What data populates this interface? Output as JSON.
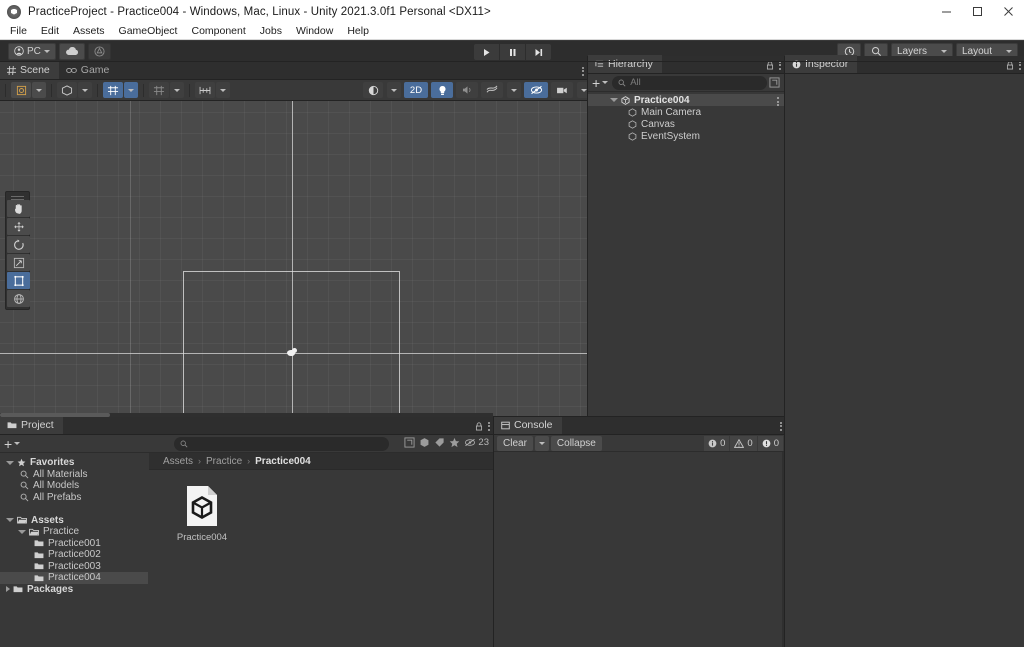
{
  "window": {
    "title": "PracticeProject - Practice004 - Windows, Mac, Linux - Unity 2021.3.0f1 Personal <DX11>",
    "app_icon": "unity-icon",
    "controls": [
      {
        "name": "minimize-button",
        "glyph": "minimize-icon"
      },
      {
        "name": "maximize-button",
        "glyph": "maximize-icon"
      },
      {
        "name": "close-button",
        "glyph": "close-icon"
      }
    ]
  },
  "menubar": {
    "items": [
      "File",
      "Edit",
      "Assets",
      "GameObject",
      "Component",
      "Jobs",
      "Window",
      "Help"
    ]
  },
  "toolbar": {
    "account_label": "PC",
    "account_icon": "account-icon",
    "cloud_icon": "cloud-icon",
    "collab_icon": "collab-icon",
    "play_icon": "play-icon",
    "pause_icon": "pause-icon",
    "step_icon": "step-icon",
    "history_icon": "undo-history-icon",
    "search_icon": "search-icon",
    "layers_label": "Layers",
    "layout_label": "Layout"
  },
  "scene": {
    "tabs": [
      {
        "label": "Scene",
        "icon": "scene-grid-icon",
        "active": true
      },
      {
        "label": "Game",
        "icon": "game-display-icon",
        "active": false
      }
    ],
    "toolbar": {
      "shading_icon": "shaded-mode-icon",
      "draw_icon": "draw-mode-icon",
      "mode_2d_label": "2D",
      "light_icon": "lighting-icon",
      "audio_icon": "audio-icon",
      "fx_icon": "effects-icon",
      "hidden_icon": "scene-visibility-icon",
      "camera_icon": "scene-camera-icon",
      "gizmos_icon": "gizmos-icon"
    },
    "tools": [
      {
        "name": "hand-tool",
        "icon": "hand-icon",
        "active": false
      },
      {
        "name": "move-tool",
        "icon": "move-icon",
        "active": false
      },
      {
        "name": "rotate-tool",
        "icon": "rotate-icon",
        "active": false
      },
      {
        "name": "scale-tool",
        "icon": "scale-icon",
        "active": false
      },
      {
        "name": "rect-tool",
        "icon": "rect-transform-icon",
        "active": true
      },
      {
        "name": "transform-tool",
        "icon": "transform-icon",
        "active": false
      }
    ],
    "viewport": {
      "canvas_rect_label": "Canvas",
      "pivot_label": "pivot-handle"
    }
  },
  "hierarchy": {
    "tab_label": "Hierarchy",
    "tab_icon": "hierarchy-icon",
    "add_label": "+",
    "search_placeholder": "All",
    "search_icon": "search-icon",
    "items": [
      {
        "label": "Practice004",
        "depth": 0,
        "icon": "scene-asset-icon",
        "expanded": true,
        "selected": true
      },
      {
        "label": "Main Camera",
        "depth": 1,
        "icon": "gameobject-icon",
        "expanded": false,
        "selected": false
      },
      {
        "label": "Canvas",
        "depth": 1,
        "icon": "gameobject-icon",
        "expanded": false,
        "selected": false
      },
      {
        "label": "EventSystem",
        "depth": 1,
        "icon": "gameobject-icon",
        "expanded": false,
        "selected": false
      }
    ]
  },
  "inspector": {
    "tab_label": "Inspector",
    "tab_icon": "info-icon"
  },
  "project": {
    "tab_label": "Project",
    "tab_icon": "folder-icon",
    "add_label": "+",
    "search_placeholder": "",
    "search_icon": "search-icon",
    "asset_count": "23",
    "tree": [
      {
        "label": "Favorites",
        "depth": 0,
        "icon": "star-icon",
        "arrow": "open",
        "bold": true,
        "selected": false
      },
      {
        "label": "All Materials",
        "depth": 1,
        "icon": "search-icon",
        "arrow": "none",
        "bold": false,
        "selected": false
      },
      {
        "label": "All Models",
        "depth": 1,
        "icon": "search-icon",
        "arrow": "none",
        "bold": false,
        "selected": false
      },
      {
        "label": "All Prefabs",
        "depth": 1,
        "icon": "search-icon",
        "arrow": "none",
        "bold": false,
        "selected": false
      },
      {
        "label": "",
        "depth": 0,
        "icon": "none",
        "arrow": "none",
        "bold": false,
        "selected": false
      },
      {
        "label": "Assets",
        "depth": 0,
        "icon": "folder-open-icon",
        "arrow": "open",
        "bold": true,
        "selected": false
      },
      {
        "label": "Practice",
        "depth": 1,
        "icon": "folder-open-icon",
        "arrow": "open",
        "bold": false,
        "selected": false
      },
      {
        "label": "Practice001",
        "depth": 2,
        "icon": "folder-icon",
        "arrow": "none",
        "bold": false,
        "selected": false
      },
      {
        "label": "Practice002",
        "depth": 2,
        "icon": "folder-icon",
        "arrow": "none",
        "bold": false,
        "selected": false
      },
      {
        "label": "Practice003",
        "depth": 2,
        "icon": "folder-icon",
        "arrow": "none",
        "bold": false,
        "selected": false
      },
      {
        "label": "Practice004",
        "depth": 2,
        "icon": "folder-icon",
        "arrow": "none",
        "bold": false,
        "selected": true
      },
      {
        "label": "Packages",
        "depth": 0,
        "icon": "folder-icon",
        "arrow": "closed",
        "bold": true,
        "selected": false
      }
    ],
    "breadcrumb": [
      "Assets",
      "Practice",
      "Practice004"
    ],
    "assets": [
      {
        "label": "Practice004",
        "icon": "unity-scene-file-icon"
      }
    ]
  },
  "console": {
    "tab_label": "Console",
    "tab_icon": "console-icon",
    "clear_label": "Clear",
    "collapse_label": "Collapse",
    "counts": [
      {
        "type": "log",
        "icon": "log-icon",
        "value": "0"
      },
      {
        "type": "warning",
        "icon": "warning-icon",
        "value": "0"
      },
      {
        "type": "error",
        "icon": "error-icon",
        "value": "0"
      }
    ]
  },
  "colors": {
    "accent_blue": "#4a6d9b",
    "panel_bg": "#383838",
    "toolbar_bg": "#2d2d2d",
    "scene_bg": "#4a4a4a",
    "selection": "#4a4a4a"
  }
}
